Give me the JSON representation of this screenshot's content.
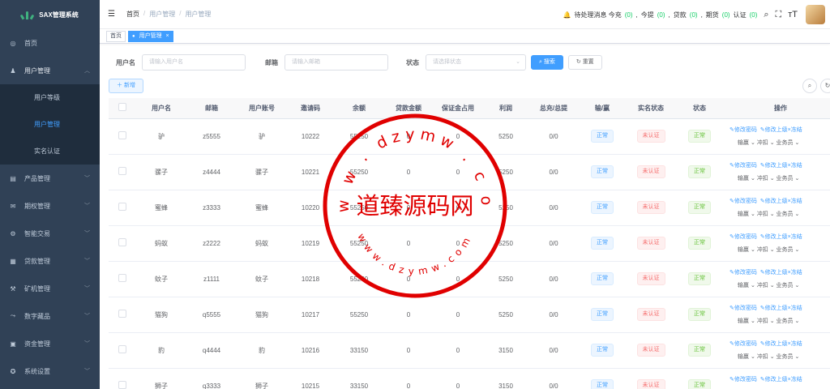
{
  "sidebar": {
    "logo": "SAX管理系统",
    "items": [
      {
        "label": "首页",
        "icon": "dashboard-icon",
        "glyph": "◎"
      },
      {
        "label": "用户管理",
        "icon": "user-icon",
        "glyph": "♟"
      },
      {
        "label": "用户等级",
        "sub": true
      },
      {
        "label": "用户管理",
        "sub": true,
        "active": true
      },
      {
        "label": "实名认证",
        "sub": true
      },
      {
        "label": "产品管理",
        "icon": "document-icon",
        "glyph": "▤"
      },
      {
        "label": "期权管理",
        "icon": "mail-icon",
        "glyph": "✉"
      },
      {
        "label": "智能交易",
        "icon": "gear-icon",
        "glyph": "⚙"
      },
      {
        "label": "贷款管理",
        "icon": "print-icon",
        "glyph": "▦"
      },
      {
        "label": "矿机管理",
        "icon": "machine-icon",
        "glyph": "⚒"
      },
      {
        "label": "数字藏品",
        "icon": "chart-icon",
        "glyph": "⤳"
      },
      {
        "label": "资金管理",
        "icon": "money-icon",
        "glyph": "▣"
      },
      {
        "label": "系统设置",
        "icon": "settings-icon",
        "glyph": "✪"
      }
    ]
  },
  "header": {
    "breadcrumb": [
      "首页",
      "用户管理",
      "用户管理"
    ],
    "pending": "待处理消息 今充",
    "today_label": "今提",
    "loan_label": "贷款",
    "futures_label": "期货",
    "auth_label": "认证",
    "counts": [
      "(0)",
      "(0)",
      "(0)",
      "(0)",
      "(0)"
    ],
    "sep": ","
  },
  "tags": {
    "home": "首页",
    "active": "用户管理",
    "close": "×"
  },
  "search": {
    "username_label": "用户名",
    "username_placeholder": "请输入用户名",
    "email_label": "邮箱",
    "email_placeholder": "请输入邮箱",
    "status_label": "状态",
    "status_placeholder": "请选择状态",
    "search_btn": "搜索",
    "reset_btn": "重置",
    "add_btn": "新增"
  },
  "table": {
    "headers": [
      "",
      "用户名",
      "邮箱",
      "用户账号",
      "邀请码",
      "余额",
      "贷款金额",
      "保证金占用",
      "利润",
      "总充/总提",
      "输/赢",
      "实名状态",
      "状态",
      "操作"
    ],
    "rows": [
      {
        "name": "驴",
        "email": "z5555",
        "account": "驴",
        "code": "10222",
        "balance": "55250",
        "loan": "0",
        "margin": "0",
        "profit": "5250",
        "total": "0/0"
      },
      {
        "name": "骡子",
        "email": "z4444",
        "account": "骡子",
        "code": "10221",
        "balance": "55250",
        "loan": "0",
        "margin": "0",
        "profit": "5250",
        "total": "0/0"
      },
      {
        "name": "蜜蜂",
        "email": "z3333",
        "account": "蜜蜂",
        "code": "10220",
        "balance": "55250",
        "loan": "0",
        "margin": "0",
        "profit": "5250",
        "total": "0/0"
      },
      {
        "name": "蚂蚁",
        "email": "z2222",
        "account": "蚂蚁",
        "code": "10219",
        "balance": "55250",
        "loan": "0",
        "margin": "0",
        "profit": "5250",
        "total": "0/0"
      },
      {
        "name": "蚊子",
        "email": "z1111",
        "account": "蚊子",
        "code": "10218",
        "balance": "55250",
        "loan": "0",
        "margin": "0",
        "profit": "5250",
        "total": "0/0"
      },
      {
        "name": "猫狗",
        "email": "q5555",
        "account": "猫狗",
        "code": "10217",
        "balance": "55250",
        "loan": "0",
        "margin": "0",
        "profit": "5250",
        "total": "0/0"
      },
      {
        "name": "豹",
        "email": "q4444",
        "account": "豹",
        "code": "10216",
        "balance": "33150",
        "loan": "0",
        "margin": "0",
        "profit": "3150",
        "total": "0/0"
      },
      {
        "name": "狮子",
        "email": "q3333",
        "account": "狮子",
        "code": "10215",
        "balance": "33150",
        "loan": "0",
        "margin": "0",
        "profit": "3150",
        "total": "0/0"
      }
    ],
    "win_badge": "正常",
    "auth_badge": "未认证",
    "status_badge": "正常",
    "op_edit_pwd": "修改密码",
    "op_edit_parent": "修改上级",
    "op_freeze": "冻结",
    "op_win": "输赢",
    "op_charge": "冲扣",
    "op_business": "业务员"
  },
  "watermark": {
    "top_text": "www.dzymw.com",
    "center_text": "道臻源码网",
    "bottom_text": "www.dzymw.com",
    "color": "#e00000"
  }
}
